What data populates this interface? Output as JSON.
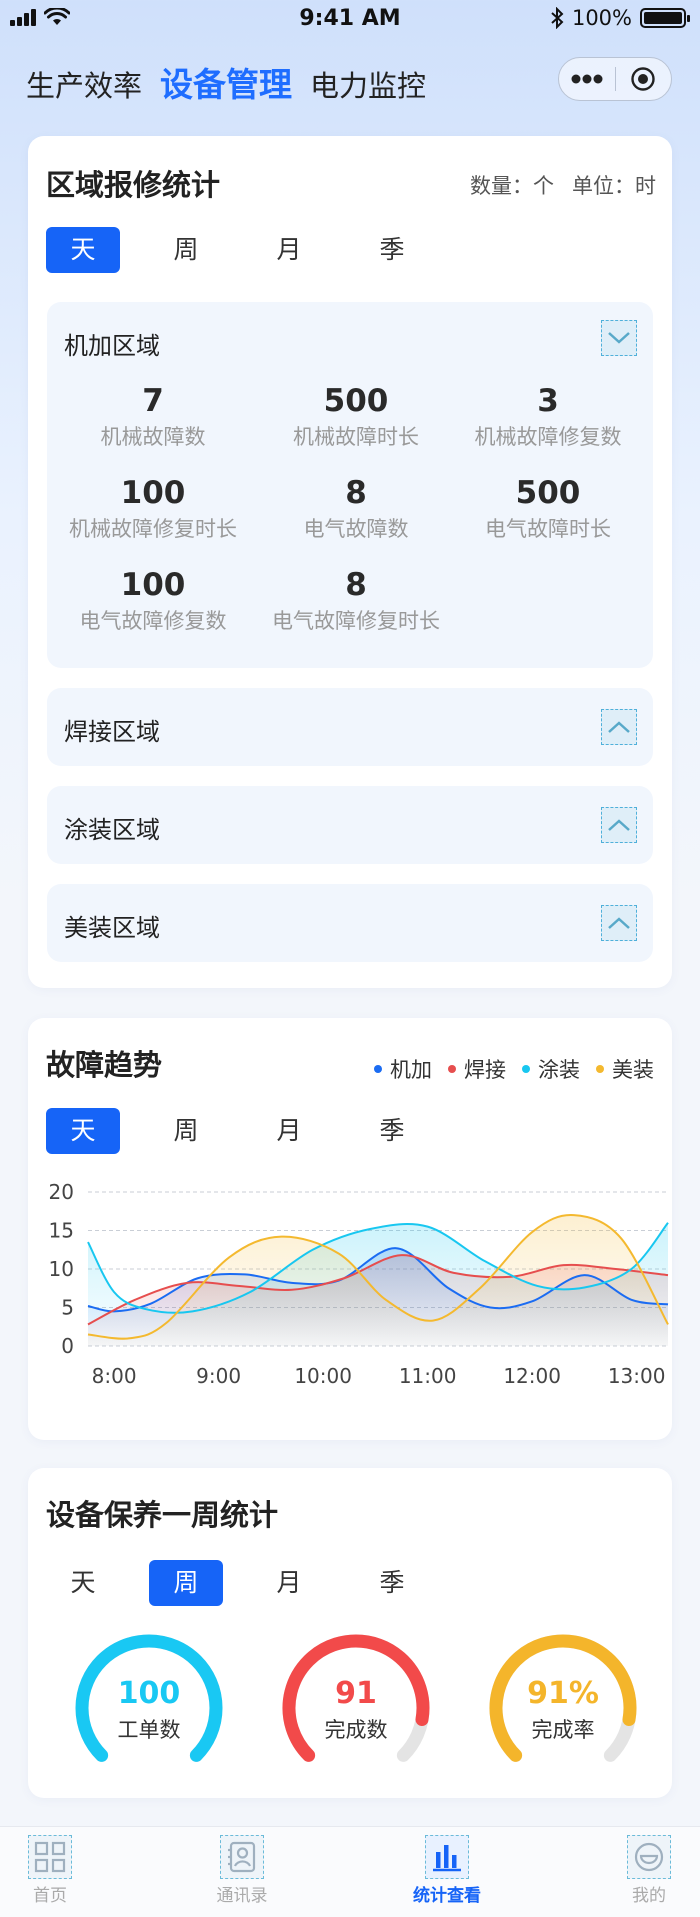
{
  "status_bar": {
    "time": "9:41 AM",
    "battery": "100%"
  },
  "top_nav": {
    "items": [
      "生产效率",
      "设备管理",
      "电力监控"
    ],
    "active_index": 1
  },
  "repair_card": {
    "title": "区域报修统计",
    "unit_count": "数量：个",
    "unit_time": "单位：时",
    "tabs": [
      "天",
      "周",
      "月",
      "季"
    ],
    "active_tab": "天",
    "areas": [
      {
        "name": "机加区域",
        "expanded": true,
        "stats": [
          {
            "value": "7",
            "label": "机械故障数"
          },
          {
            "value": "500",
            "label": "机械故障时长"
          },
          {
            "value": "3",
            "label": "机械故障修复数"
          },
          {
            "value": "100",
            "label": "机械故障修复时长"
          },
          {
            "value": "8",
            "label": "电气故障数"
          },
          {
            "value": "500",
            "label": "电气故障时长"
          },
          {
            "value": "100",
            "label": "电气故障修复数"
          },
          {
            "value": "8",
            "label": "电气故障修复时长"
          }
        ]
      },
      {
        "name": "焊接区域",
        "expanded": false
      },
      {
        "name": "涂装区域",
        "expanded": false
      },
      {
        "name": "美装区域",
        "expanded": false
      }
    ]
  },
  "trend_card": {
    "title": "故障趋势",
    "tabs": [
      "天",
      "周",
      "月",
      "季"
    ],
    "active_tab": "天"
  },
  "chart_data": {
    "type": "area",
    "x_labels": [
      "8:00",
      "9:00",
      "10:00",
      "11:00",
      "12:00",
      "13:00"
    ],
    "x_range": [
      7.75,
      13.3
    ],
    "y_ticks": [
      "0",
      "5",
      "10",
      "15",
      "20"
    ],
    "ylim": [
      0,
      20
    ],
    "grid": true,
    "legend_position": "top-right",
    "series": [
      {
        "name": "机加",
        "color": "#1b6cf2",
        "points": [
          [
            7.75,
            5.2
          ],
          [
            8.0,
            4.5
          ],
          [
            8.35,
            5.5
          ],
          [
            8.8,
            8.8
          ],
          [
            9.25,
            9.3
          ],
          [
            9.7,
            8.2
          ],
          [
            10.15,
            8.5
          ],
          [
            10.7,
            12.7
          ],
          [
            11.2,
            7.5
          ],
          [
            11.6,
            5.0
          ],
          [
            12.0,
            5.8
          ],
          [
            12.5,
            9.2
          ],
          [
            12.95,
            6.0
          ],
          [
            13.3,
            5.4
          ]
        ]
      },
      {
        "name": "焊接",
        "color": "#e64e4e",
        "points": [
          [
            7.75,
            2.8
          ],
          [
            8.2,
            6.0
          ],
          [
            8.7,
            8.2
          ],
          [
            9.2,
            7.8
          ],
          [
            9.7,
            7.3
          ],
          [
            10.2,
            8.8
          ],
          [
            10.75,
            11.8
          ],
          [
            11.25,
            9.5
          ],
          [
            11.8,
            9.0
          ],
          [
            12.3,
            10.5
          ],
          [
            12.8,
            10.0
          ],
          [
            13.3,
            9.2
          ]
        ]
      },
      {
        "name": "涂装",
        "color": "#18c7f0",
        "points": [
          [
            7.75,
            13.5
          ],
          [
            8.0,
            7.0
          ],
          [
            8.3,
            4.8
          ],
          [
            8.75,
            4.5
          ],
          [
            9.3,
            7.0
          ],
          [
            9.9,
            12.5
          ],
          [
            10.45,
            15.2
          ],
          [
            11.0,
            15.5
          ],
          [
            11.55,
            11.0
          ],
          [
            12.05,
            7.8
          ],
          [
            12.5,
            7.6
          ],
          [
            12.95,
            10.0
          ],
          [
            13.3,
            16.0
          ]
        ]
      },
      {
        "name": "美装",
        "color": "#f4b92f",
        "points": [
          [
            7.75,
            1.5
          ],
          [
            8.15,
            1.0
          ],
          [
            8.5,
            3.0
          ],
          [
            9.1,
            11.5
          ],
          [
            9.6,
            14.2
          ],
          [
            10.15,
            12.0
          ],
          [
            10.6,
            6.0
          ],
          [
            11.05,
            3.3
          ],
          [
            11.5,
            7.5
          ],
          [
            12.0,
            14.8
          ],
          [
            12.4,
            17.0
          ],
          [
            12.85,
            14.0
          ],
          [
            13.3,
            2.8
          ]
        ]
      }
    ]
  },
  "maintenance_card": {
    "title": "设备保养一周统计",
    "tabs": [
      "天",
      "周",
      "月",
      "季"
    ],
    "active_tab": "周",
    "gauges": [
      {
        "value": "100",
        "label": "工单数",
        "color": "#19c8f3",
        "fraction": 1.0
      },
      {
        "value": "91",
        "label": "完成数",
        "color": "#f24a4a",
        "fraction": 0.87
      },
      {
        "value": "91%",
        "label": "完成率",
        "color": "#f4b52b",
        "fraction": 0.87
      }
    ]
  },
  "tab_bar": {
    "items": [
      {
        "label": "首页",
        "icon": "home-grid-icon"
      },
      {
        "label": "通讯录",
        "icon": "contacts-icon"
      },
      {
        "label": "统计查看",
        "icon": "bar-chart-icon"
      },
      {
        "label": "我的",
        "icon": "profile-icon"
      }
    ],
    "active_index": 2
  }
}
